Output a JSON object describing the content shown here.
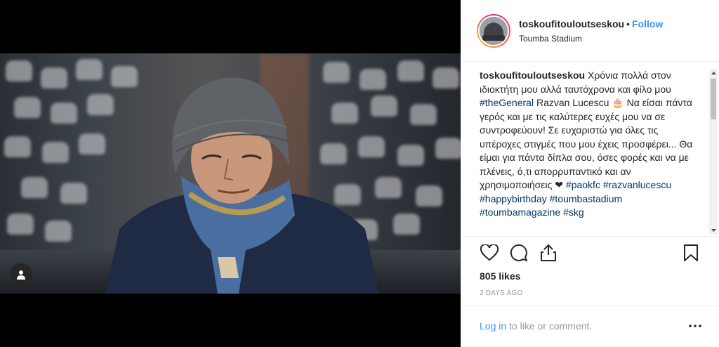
{
  "post": {
    "username": "toskoufitouloutseskou",
    "follow_separator": "•",
    "follow_label": "Follow",
    "location": "Toumba Stadium",
    "caption": {
      "username": "toskoufitouloutseskou",
      "text_1": " Χρόνια πολλά στον ιδιοκτήτη μου αλλά ταυτόχρονα και φίλο μου ",
      "tag_general": "#theGeneral",
      "text_2": " Razvan Lucescu 🎂 Να είσαι πάντα γερός και με τις καλύτερες ευχές μου να σε συντροφεύουν! Σε ευχαριστώ για όλες τις υπέροχες στιγμές που μου έχεις προσφέρει... Θα είμαι για πάντα δίπλα σου, όσες φορές και να με πλένεις, ό,τι απορρυπαντικό και αν χρησιμοποιήσεις ❤ ",
      "tag_paokfc": "#paokfc",
      "tag_razvan": "#razvanlucescu",
      "tag_birthday": "#happybirthday",
      "tag_toumba": "#toumbastadium",
      "tag_magazine": "#toumbamagazine",
      "tag_skg": "#skg"
    },
    "likes": "805 likes",
    "time": "2 DAYS AGO",
    "login_link": "Log in",
    "login_text": " to like or comment."
  },
  "icons": {
    "like": "heart-icon",
    "comment": "comment-icon",
    "share": "share-icon",
    "save": "bookmark-icon",
    "more": "more-icon",
    "user_tag": "user-icon"
  },
  "colors": {
    "link": "#3897f0",
    "hashtag": "#003569",
    "text": "#262626",
    "muted": "#999999"
  }
}
